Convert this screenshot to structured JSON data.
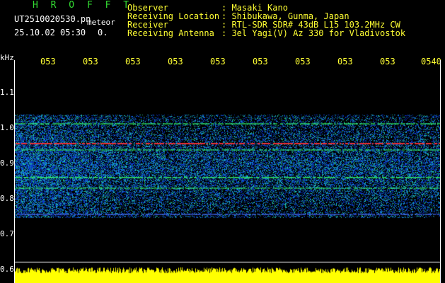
{
  "brand": "H R O F F T",
  "file_name": "UT2510020530.pn",
  "meteor_label": "meteor",
  "date_time": "25.10.02 05:30",
  "count": "0.",
  "info": [
    {
      "label": "Observer",
      "value": ": Masaki Kano"
    },
    {
      "label": "Receiving Location",
      "value": ": Shibukawa, Gunma, Japan"
    },
    {
      "label": "Receiver",
      "value": ": RTL-SDR SDR# 43dB L15 103.2MHz CW"
    },
    {
      "label": "Receiving Antenna",
      "value": ": 3el Yagi(V) Az 330 for Vladivostok"
    }
  ],
  "y_axis_unit": "kHz",
  "y_ticks": [
    "1.1",
    "1.0",
    "0.9",
    "0.8",
    "0.7",
    "0.6"
  ],
  "x_ticks": [
    "053",
    "053",
    "053",
    "053",
    "053",
    "053",
    "053",
    "053",
    "053",
    "0540"
  ],
  "colors": {
    "background": "#000000",
    "label_yellow": "#ffff33",
    "text_white": "#ffffff",
    "brand_green": "#33dd33",
    "noise_blue": "#1a3fa8",
    "line_red": "#ff3030",
    "line_green": "#33ff66",
    "level_yellow": "#ffff00"
  }
}
